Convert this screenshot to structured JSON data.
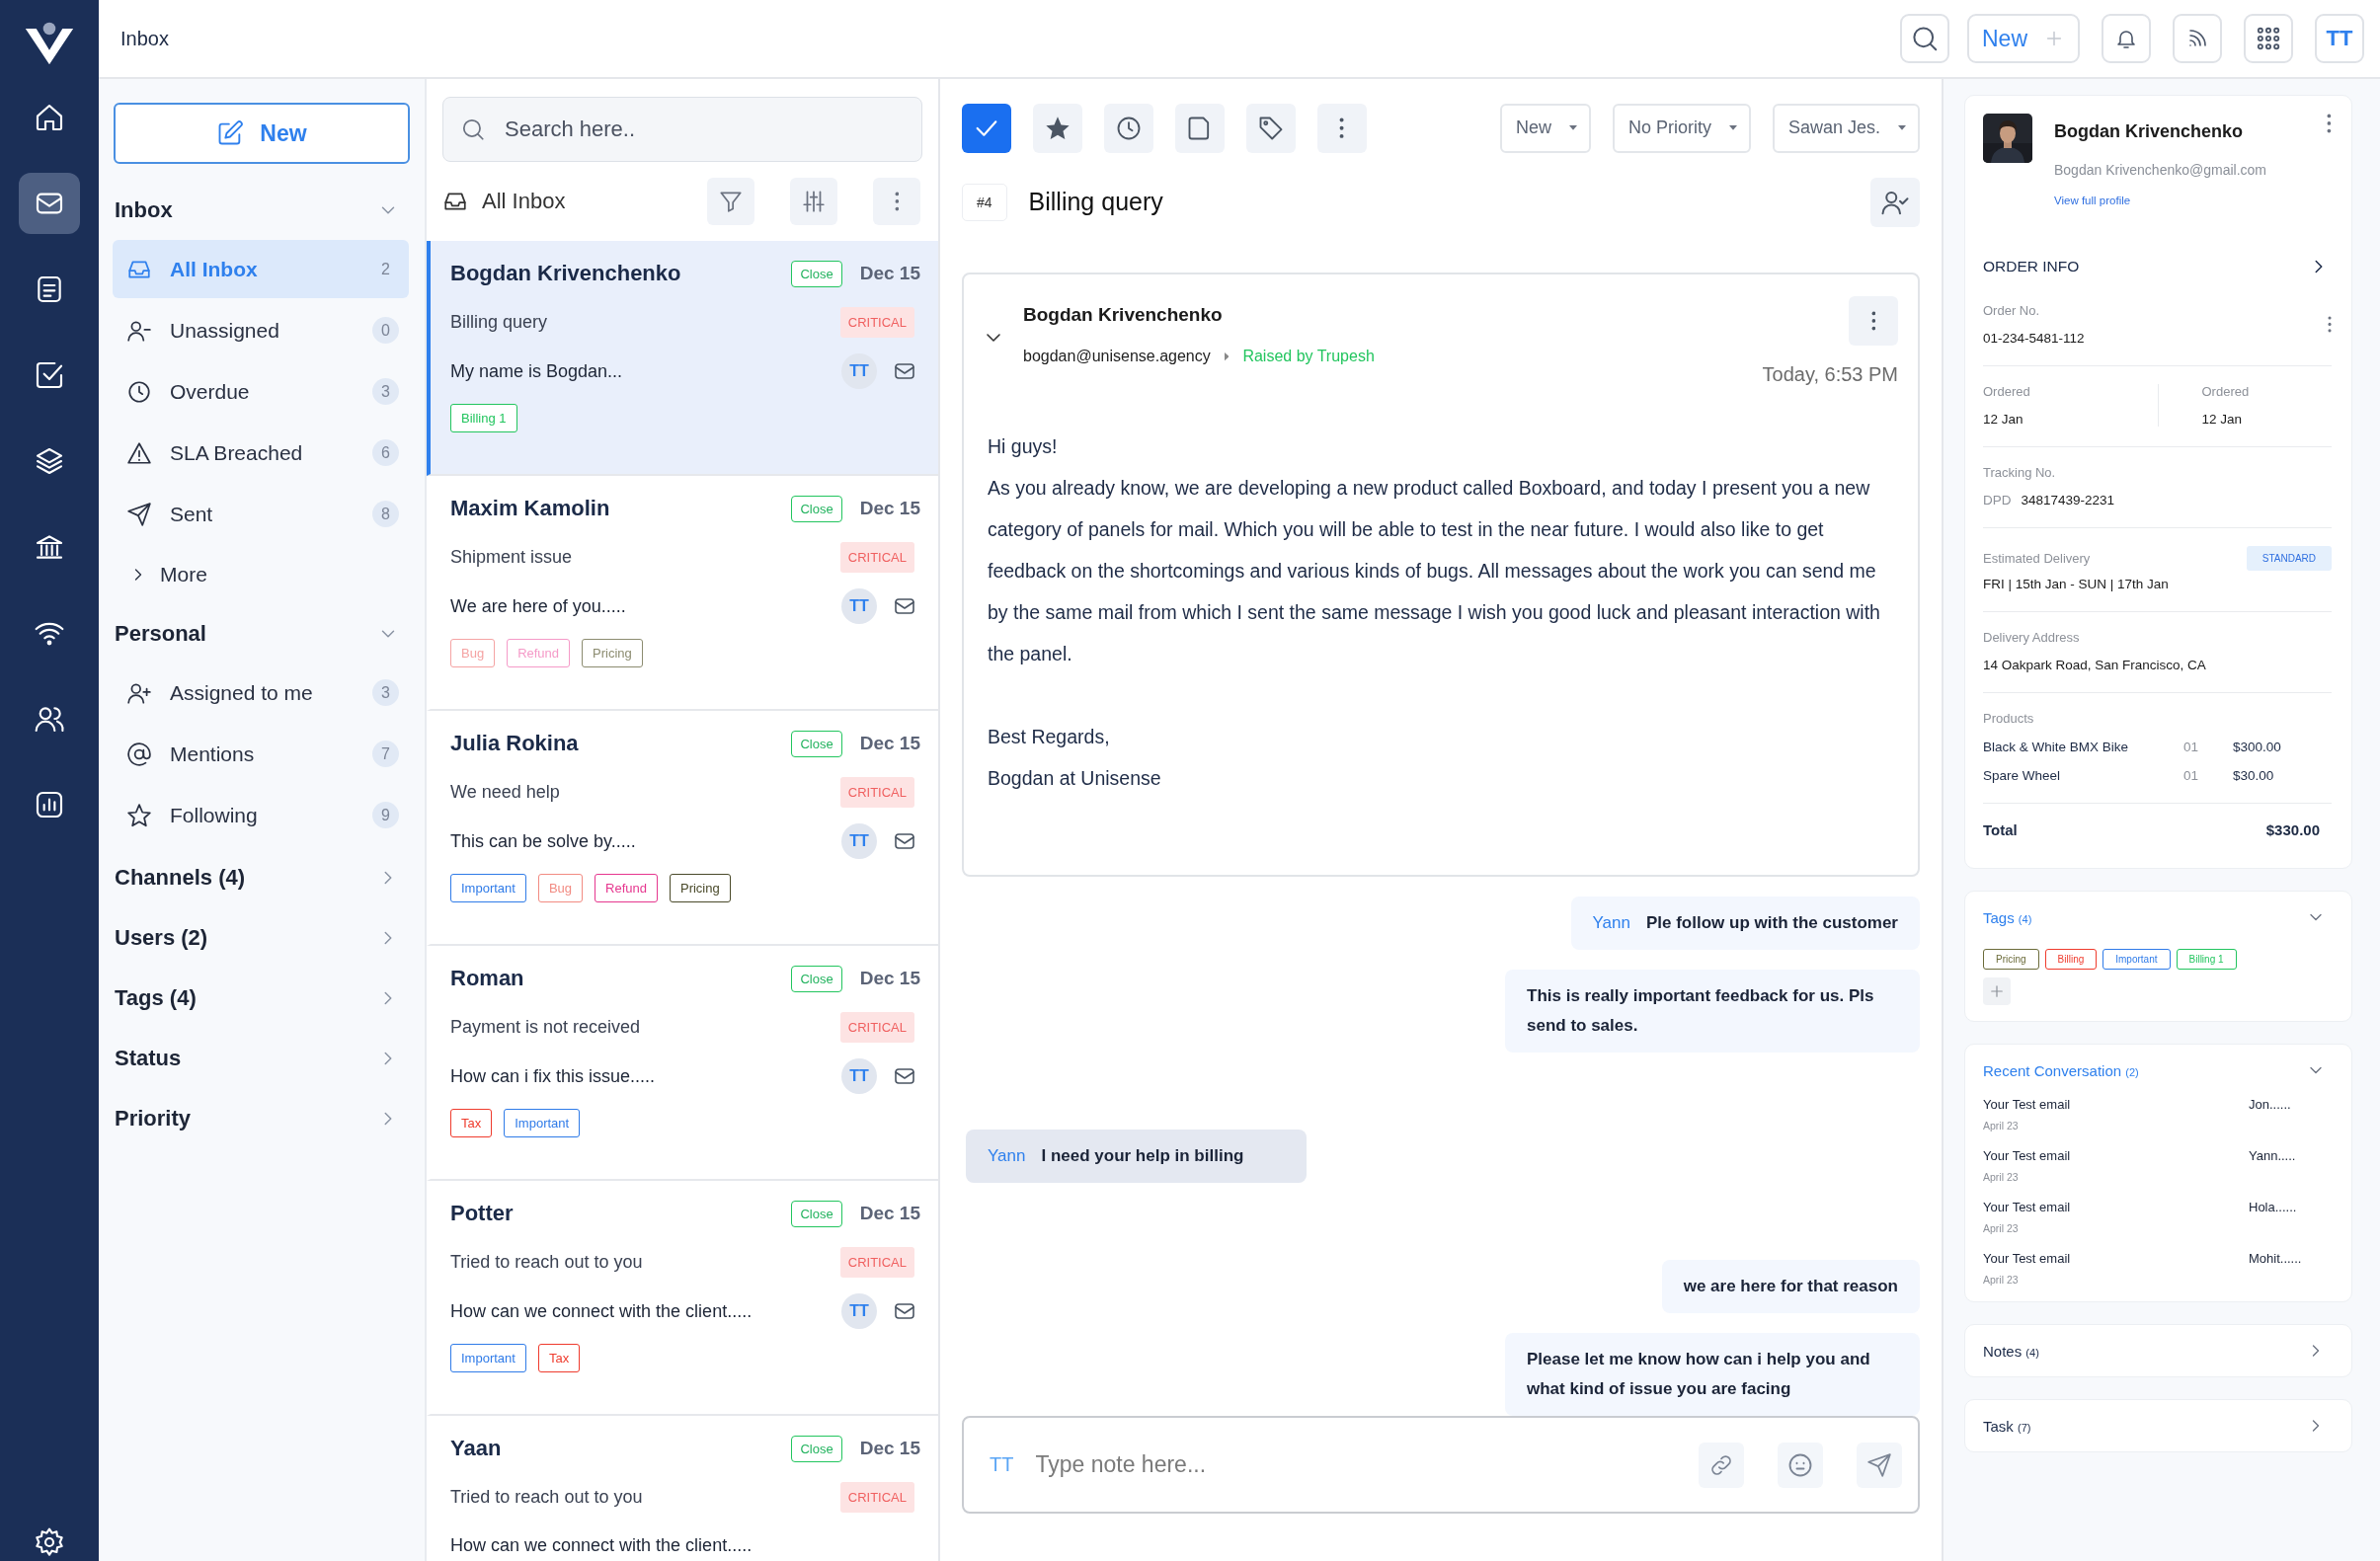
{
  "top_bar": {
    "title": "Inbox",
    "new_button": "New",
    "avatar": "TT"
  },
  "nav": {
    "items": [
      {
        "selected": false
      },
      {
        "selected": true
      },
      {
        "selected": false
      },
      {
        "selected": false
      },
      {
        "selected": false
      },
      {
        "selected": false
      },
      {
        "selected": false
      },
      {
        "selected": false
      },
      {
        "selected": false
      }
    ]
  },
  "sidebar": {
    "new_button": "New",
    "sections": [
      {
        "title": "Inbox",
        "expanded": true,
        "items": [
          {
            "label": "All Inbox",
            "count": "2",
            "selected": true
          },
          {
            "label": "Unassigned",
            "count": "0",
            "selected": false
          },
          {
            "label": "Overdue",
            "count": "3",
            "selected": false
          },
          {
            "label": "SLA Breached",
            "count": "6",
            "selected": false
          },
          {
            "label": "Sent",
            "count": "8",
            "selected": false
          }
        ],
        "more": "More"
      },
      {
        "title": "Personal",
        "expanded": true,
        "items": [
          {
            "label": "Assigned to me",
            "count": "3",
            "selected": false
          },
          {
            "label": "Mentions",
            "count": "7",
            "selected": false
          },
          {
            "label": "Following",
            "count": "9",
            "selected": false
          }
        ]
      },
      {
        "title": "Channels (4)",
        "expanded": false
      },
      {
        "title": "Users (2)",
        "expanded": false
      },
      {
        "title": "Tags (4)",
        "expanded": false
      },
      {
        "title": "Status",
        "expanded": false
      },
      {
        "title": "Priority",
        "expanded": false
      }
    ]
  },
  "conversations": {
    "search_placeholder": "Search here..",
    "title": "All Inbox",
    "items": [
      {
        "name": "Bogdan Krivenchenko",
        "status": "Close",
        "date": "Dec 15",
        "subject": "Billing query",
        "priority": "CRITICAL",
        "preview": "My name is Bogdan...",
        "avatar": "TT",
        "selected": true,
        "tags": [
          {
            "label": "Billing 1",
            "color": "#22c55e"
          }
        ]
      },
      {
        "name": "Maxim Kamolin",
        "status": "Close",
        "date": "Dec 15",
        "subject": "Shipment issue",
        "priority": "CRITICAL",
        "preview": "We are here of you.....",
        "avatar": "TT",
        "selected": false,
        "tags": [
          {
            "label": "Bug",
            "color": "#f5a3a3"
          },
          {
            "label": "Refund",
            "color": "#f59ac8"
          },
          {
            "label": "Pricing",
            "color": "#8c8c70"
          }
        ]
      },
      {
        "name": "Julia Rokina",
        "status": "Close",
        "date": "Dec 15",
        "subject": "We need help",
        "priority": "CRITICAL",
        "preview": "This can be solve by.....",
        "avatar": "TT",
        "selected": false,
        "tags": [
          {
            "label": "Important",
            "color": "#2f7be8"
          },
          {
            "label": "Bug",
            "color": "#f28b82"
          },
          {
            "label": "Refund",
            "color": "#e6378f"
          },
          {
            "label": "Pricing",
            "color": "#4a4a2a"
          }
        ]
      },
      {
        "name": "Roman",
        "status": "Close",
        "date": "Dec 15",
        "subject": "Payment is not received",
        "priority": "CRITICAL",
        "preview": "How can i fix this issue.....",
        "avatar": "TT",
        "selected": false,
        "tags": [
          {
            "label": "Tax",
            "color": "#ef3b2d"
          },
          {
            "label": "Important",
            "color": "#2f7be8"
          }
        ]
      },
      {
        "name": "Potter",
        "status": "Close",
        "date": "Dec 15",
        "subject": "Tried to reach out to you",
        "priority": "CRITICAL",
        "preview": "How can we connect with the client.....",
        "avatar": "TT",
        "selected": false,
        "tags": [
          {
            "label": "Important",
            "color": "#2f7be8"
          },
          {
            "label": "Tax",
            "color": "#ef3b2d"
          }
        ]
      },
      {
        "name": "Yaan",
        "status": "Close",
        "date": "Dec 15",
        "subject": "Tried to reach out to you",
        "priority": "CRITICAL",
        "preview": "How can we connect with the client.....",
        "selected": false
      }
    ]
  },
  "ticket": {
    "dropdowns": [
      {
        "label": "New"
      },
      {
        "label": "No Priority"
      },
      {
        "label": "Sawan Jes."
      }
    ],
    "number": "#4",
    "subject": "Billing query",
    "email": {
      "sender": "Bogdan Krivenchenko",
      "address": "bogdan@unisense.agency",
      "raised_by": "Raised by Trupesh",
      "time": "Today, 6:53 PM",
      "expanded": true,
      "paragraphs": [
        "Hi guys!",
        "As you already know, we are developing a new product called Boxboard, and today I present you a new category of panels for mail. Which you will be able to test in the near future. I would also like to get feedback on the shortcomings and various kinds of bugs. All messages about the work you can send me by the same mail from which I sent the same message I wish you good luck and pleasant interaction with the panel."
      ],
      "closing": [
        "Best Regards,",
        "Bogdan at Unisense"
      ]
    },
    "notes": [
      {
        "kind": "outgoing",
        "author": "Yann",
        "text": "Ple follow up with the customer"
      },
      {
        "kind": "outgoing",
        "text": "This is really important feedback for us. Pls send to sales."
      },
      {
        "kind": "incoming",
        "author": "Yann",
        "text": "I need your help in billing"
      },
      {
        "kind": "outgoing",
        "text": "we are here for that reason"
      },
      {
        "kind": "outgoing",
        "text": "Please let me know how can i help you and what kind of issue you are facing"
      }
    ],
    "composer": {
      "avatar": "TT",
      "placeholder": "Type note here..."
    }
  },
  "customer": {
    "name": "Bogdan Krivenchenko",
    "email": "Bogdan Krivenchenko@gmail.com",
    "profile_link": "View full profile",
    "order_info": {
      "title": "ORDER INFO",
      "order_no": {
        "label": "Order No.",
        "value": "01-234-5481-112"
      },
      "ordered": [
        {
          "label": "Ordered",
          "value": "12 Jan"
        },
        {
          "label": "Ordered",
          "value": "12 Jan"
        }
      ],
      "tracking": {
        "label": "Tracking No.",
        "carrier": "DPD",
        "value": "34817439-2231"
      },
      "delivery": {
        "label": "Estimated Delivery",
        "badge": "STANDARD",
        "value": "FRI | 15th Jan - SUN | 17th Jan"
      },
      "address": {
        "label": "Delivery Address",
        "value": "14 Oakpark Road, San Francisco, CA"
      },
      "products": {
        "label": "Products",
        "items": [
          {
            "name": "Black & White BMX Bike",
            "qty": "01",
            "price": "$300.00"
          },
          {
            "name": "Spare Wheel",
            "qty": "01",
            "price": "$30.00"
          }
        ]
      },
      "total": {
        "label": "Total",
        "value": "$330.00"
      }
    }
  },
  "panel_sections": [
    {
      "kind": "tags",
      "title": "Tags",
      "count": "(4)",
      "expanded": true,
      "tags": [
        {
          "label": "Pricing",
          "color": "#6b6b3a"
        },
        {
          "label": "Billing",
          "color": "#ef3b2d"
        },
        {
          "label": "Important",
          "color": "#2f7be8"
        },
        {
          "label": "Billing 1",
          "color": "#22c55e"
        }
      ]
    },
    {
      "kind": "recent",
      "title": "Recent Conversation",
      "count": "(2)",
      "expanded": true,
      "items": [
        {
          "subject": "Your Test email",
          "date": "April 23",
          "from": "Jon......"
        },
        {
          "subject": "Your Test email",
          "date": "April 23",
          "from": "Yann....."
        },
        {
          "subject": "Your Test email",
          "date": "April 23",
          "from": "Hola......"
        },
        {
          "subject": "Your Test email",
          "date": "April 23",
          "from": "Mohit......"
        }
      ]
    },
    {
      "kind": "link",
      "title": "Notes",
      "count": "(4)",
      "expanded": false
    },
    {
      "kind": "link",
      "title": "Task",
      "count": "(7)",
      "expanded": false
    }
  ]
}
